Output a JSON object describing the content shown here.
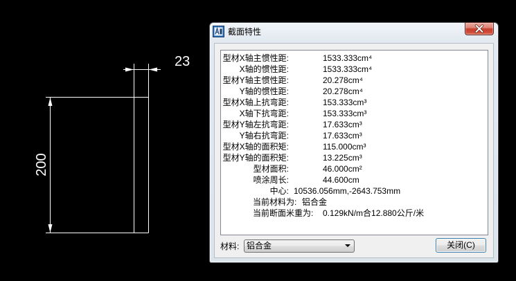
{
  "colors": {
    "canvas_background": "#000000",
    "drawing_line": "#ffffff",
    "close_button_red": "#c8412f"
  },
  "drawing": {
    "dim_width_text": "23",
    "dim_height_text": "200"
  },
  "dialog": {
    "title": "截面特性",
    "title_icon": "app-icon",
    "close_icon": "close-icon",
    "properties": [
      {
        "label": "型材X轴主惯性距:",
        "value": "1533.333cm⁴"
      },
      {
        "label": "X轴的惯性距:",
        "value": "1533.333cm⁴"
      },
      {
        "label": "型材Y轴主惯性距:",
        "value": "20.278cm⁴"
      },
      {
        "label": "Y轴的惯性距:",
        "value": "20.278cm⁴"
      },
      {
        "label": "型材X轴上抗弯距:",
        "value": "153.333cm³"
      },
      {
        "label": "X轴下抗弯距:",
        "value": "153.333cm³"
      },
      {
        "label": "型材Y轴左抗弯距:",
        "value": "17.633cm³"
      },
      {
        "label": "Y轴右抗弯距:",
        "value": "17.633cm³"
      },
      {
        "label": "型材X轴的面积矩:",
        "value": "115.000cm³"
      },
      {
        "label": "型材Y轴的面积矩:",
        "value": "13.225cm³"
      },
      {
        "label": "型材面积:",
        "value": "46.000cm²"
      },
      {
        "label": "喷涂周长:",
        "value": "44.600cm"
      },
      {
        "label": "中心:",
        "value": "10536.056mm,-2643.753mm"
      },
      {
        "label": "当前材料为:",
        "value": "铝合金"
      },
      {
        "label": "当前断面米重为:",
        "value": "0.129kN/m合12.880公斤/米"
      }
    ],
    "material_label": "材料:",
    "material_selected": "铝合金",
    "combo_icon": "chevron-down-icon",
    "close_button_label": "关闭(C)"
  }
}
